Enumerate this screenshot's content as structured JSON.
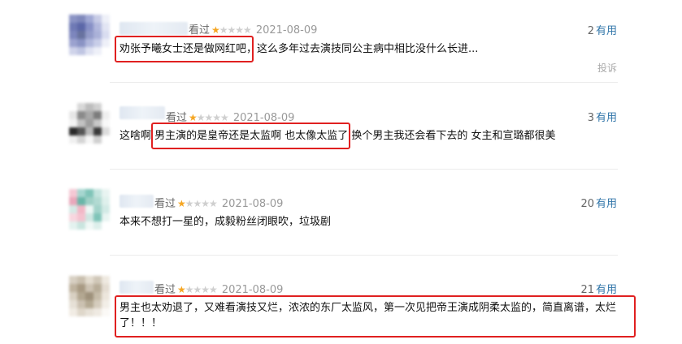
{
  "reviews": [
    {
      "status": "看过",
      "rating": 1,
      "date": "2021-08-09",
      "votes": "2",
      "useful_label": "有用",
      "text": "劝张予曦女士还是做网红吧，这么多年过去演技同公主病中相比没什么长进...",
      "report": "投诉"
    },
    {
      "status": "看过",
      "rating": 1,
      "date": "2021-08-09",
      "votes": "3",
      "useful_label": "有用",
      "text": "这啥啊 男主演的是皇帝还是太监啊 也太像太监了 换个男主我还会看下去的 女主和宣璐都很美"
    },
    {
      "status": "看过",
      "rating": 1,
      "date": "2021-08-09",
      "votes": "20",
      "useful_label": "有用",
      "text": "本来不想打一星的，成毅粉丝闭眼吹，垃圾剧"
    },
    {
      "status": "看过",
      "rating": 1,
      "date": "2021-08-09",
      "votes": "21",
      "useful_label": "有用",
      "text_line1": "男主也太劝退了，又难看演技又烂，浓浓的东厂太监风，第一次见把帝王演成阴柔太监的，简直离谱，太烂",
      "text_line2": "了！！！"
    }
  ],
  "colors": {
    "accent": "#3377aa",
    "highlight": "#e02020",
    "star": "#f5a623"
  }
}
